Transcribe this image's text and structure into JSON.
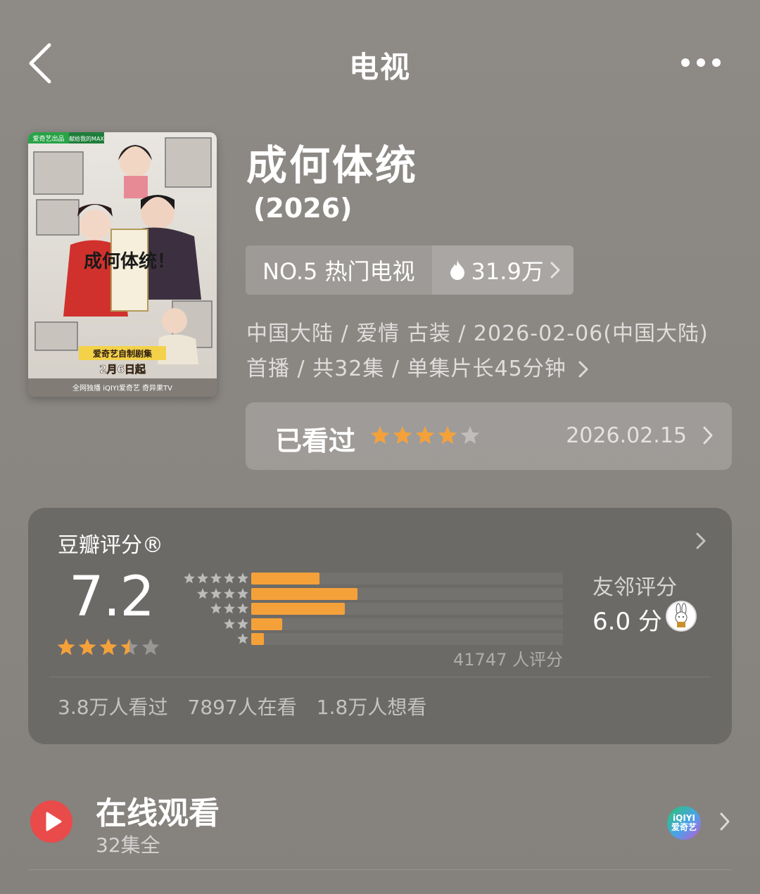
{
  "header": {
    "title": "电视"
  },
  "show": {
    "title": "成何体统",
    "year": "(2026)",
    "rank_label": "NO.5 热门电视",
    "heat": "31.9万",
    "meta": "中国大陆 / 爱情 古装 / 2026-02-06(中国大陆) 首播 / 共32集 / 单集片长45分钟"
  },
  "poster": {
    "badge_left": "爱奇艺出品",
    "badge_right": "献给我的MAX",
    "calligraphy": "成何体统！",
    "tag": "爱奇艺自制剧集",
    "date": "2月6日起",
    "platforms": "全网独播 iQIYI爱奇艺 奇异果TV"
  },
  "my_status": {
    "label": "已看过",
    "stars": 4,
    "date": "2026.02.15"
  },
  "rating": {
    "title": "豆瓣评分®",
    "score": "7.2",
    "star_value": 3.5,
    "distribution": [
      0.22,
      0.34,
      0.3,
      0.1,
      0.04
    ],
    "count": "41747 人评分",
    "friends_label": "友邻评分",
    "friends_score": "6.0 分",
    "stats": [
      "3.8万人看过",
      "7897人在看",
      "1.8万人想看"
    ]
  },
  "online": {
    "title": "在线观看",
    "sub": "32集全",
    "platform": "iQIYI 爱奇艺"
  },
  "colors": {
    "accent": "#f5a139",
    "play": "#e94a4a",
    "bg": "#8a8682",
    "card": "#6c6a67"
  }
}
